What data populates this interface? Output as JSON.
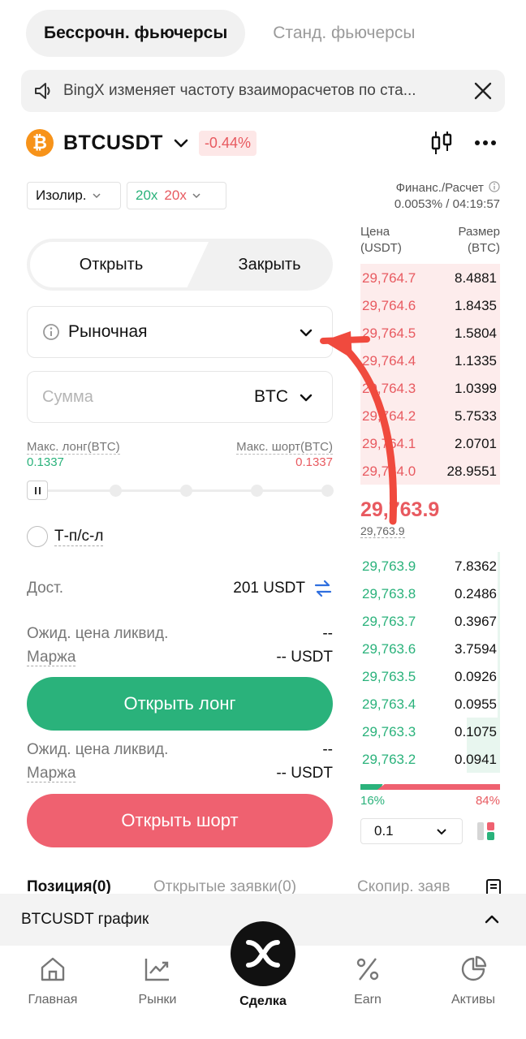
{
  "header": {
    "tab_active": "Бессрочн. фьючерсы",
    "tab_inactive": "Станд. фьючерсы"
  },
  "notice": {
    "text": "BingX изменяет частоту взаиморасчетов по ста..."
  },
  "pair": {
    "coin_glyph": "₿",
    "name": "BTCUSDT",
    "change": "-0.44%"
  },
  "order_form": {
    "margin_mode": "Изолир.",
    "leverage_long": "20x",
    "leverage_short": "20x",
    "open_label": "Открыть",
    "close_label": "Закрыть",
    "order_type": "Рыночная",
    "amount_placeholder": "Сумма",
    "amount_unit": "BTC",
    "max_long_label": "Макс. лонг(BTC)",
    "max_long_value": "0.1337",
    "max_short_label": "Макс. шорт(BTC)",
    "max_short_value": "0.1337",
    "tpsl_label": "Т-п/с-л",
    "available_label": "Дост.",
    "available_value": "201 USDT",
    "long_liq_label": "Ожид. цена ликвид.",
    "long_liq_value": "--",
    "long_margin_label": "Маржа",
    "long_margin_value": "-- USDT",
    "open_long": "Открыть лонг",
    "short_liq_label": "Ожид. цена ликвид.",
    "short_liq_value": "--",
    "short_margin_label": "Маржа",
    "short_margin_value": "-- USDT",
    "open_short": "Открыть шорт"
  },
  "orderbook": {
    "funding_label": "Финанс./Расчет",
    "funding_value": "0.0053% / 04:19:57",
    "price_header_1": "Цена",
    "price_header_2": "(USDT)",
    "size_header_1": "Размер",
    "size_header_2": "(BTC)",
    "asks": [
      {
        "price": "29,764.7",
        "size": "8.4881",
        "depth": 1.0
      },
      {
        "price": "29,764.6",
        "size": "1.8435",
        "depth": 1.0
      },
      {
        "price": "29,764.5",
        "size": "1.5804",
        "depth": 1.0
      },
      {
        "price": "29,764.4",
        "size": "1.1335",
        "depth": 1.0
      },
      {
        "price": "29,764.3",
        "size": "1.0399",
        "depth": 1.0
      },
      {
        "price": "29,764.2",
        "size": "5.7533",
        "depth": 1.0
      },
      {
        "price": "29,764.1",
        "size": "2.0701",
        "depth": 1.0
      },
      {
        "price": "29,764.0",
        "size": "28.9551",
        "depth": 1.0
      }
    ],
    "last_price": "29,763.9",
    "mark_price": "29,763.9",
    "bids": [
      {
        "price": "29,763.9",
        "size": "7.8362",
        "depth": 0.02
      },
      {
        "price": "29,763.8",
        "size": "0.2486",
        "depth": 0.02
      },
      {
        "price": "29,763.7",
        "size": "0.3967",
        "depth": 0.02
      },
      {
        "price": "29,763.6",
        "size": "3.7594",
        "depth": 0.02
      },
      {
        "price": "29,763.5",
        "size": "0.0926",
        "depth": 0.02
      },
      {
        "price": "29,763.4",
        "size": "0.0955",
        "depth": 0.02
      },
      {
        "price": "29,763.3",
        "size": "0.1075",
        "depth": 0.24
      },
      {
        "price": "29,763.2",
        "size": "0.0941",
        "depth": 0.24
      }
    ],
    "buy_ratio": "16%",
    "sell_ratio": "84%",
    "buy_fraction": 0.16,
    "precision": "0.1"
  },
  "positions": {
    "tab_positions": "Позиция(0)",
    "tab_orders": "Открытые заявки(0)",
    "tab_copy": "Скопир. заяв"
  },
  "chart_strip": {
    "label": "BTCUSDT график"
  },
  "nav": {
    "home": "Главная",
    "markets": "Рынки",
    "trade": "Сделка",
    "earn": "Earn",
    "assets": "Активы"
  },
  "colors": {
    "green": "#2ab27b",
    "red": "#e85a60",
    "short_button": "#ef6170",
    "annotation_arrow": "#f04a3e"
  }
}
